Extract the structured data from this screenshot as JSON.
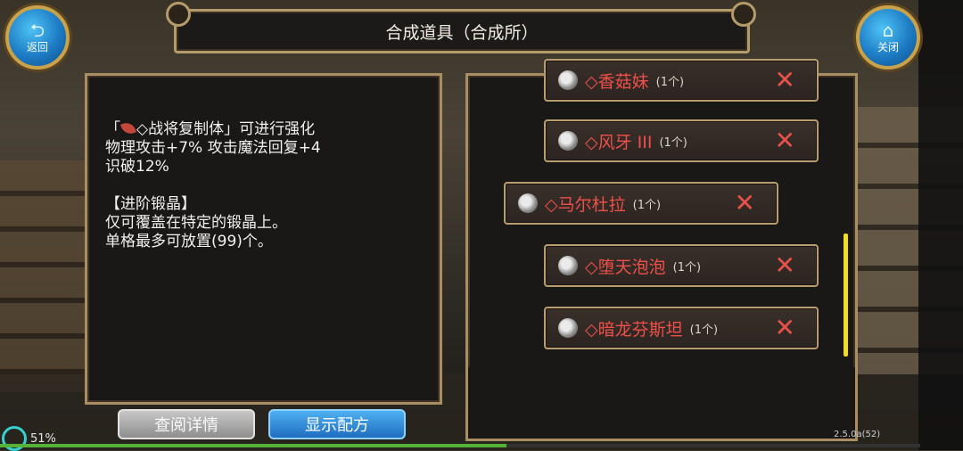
{
  "header": {
    "title": "合成道具（合成所）",
    "back_label": "返回",
    "close_label": "关闭"
  },
  "description": {
    "lines": [
      [
        "「",
        "◇战将复制体」可进行强化"
      ],
      "物理攻击+7% 攻击魔法回复+4",
      "识破12%",
      "",
      "【进阶锻晶】",
      "仅可覆盖在特定的锻晶上。",
      "单格最多可放置(99)个。"
    ]
  },
  "list": {
    "items": [
      {
        "name": "◇香菇妹",
        "count": "(1个)",
        "selected": false
      },
      {
        "name": "◇风牙 III",
        "count": "(1个)",
        "selected": false
      },
      {
        "name": "◇马尔杜拉",
        "count": "(1个)",
        "selected": true
      },
      {
        "name": "◇堕天泡泡",
        "count": "(1个)",
        "selected": false
      },
      {
        "name": "◇暗龙芬斯坦",
        "count": "(1个)",
        "selected": false
      }
    ],
    "remove_glyph": "✕"
  },
  "buttons": {
    "detail": "查阅详情",
    "recipe": "显示配方"
  },
  "status": {
    "battery": "51%",
    "version": "2.5.0a(52)",
    "progress": 0.55
  },
  "colors": {
    "item_text": "#ef4f4a",
    "panel_border": "#a88e62",
    "recipe_button": "#1e6dbf"
  }
}
